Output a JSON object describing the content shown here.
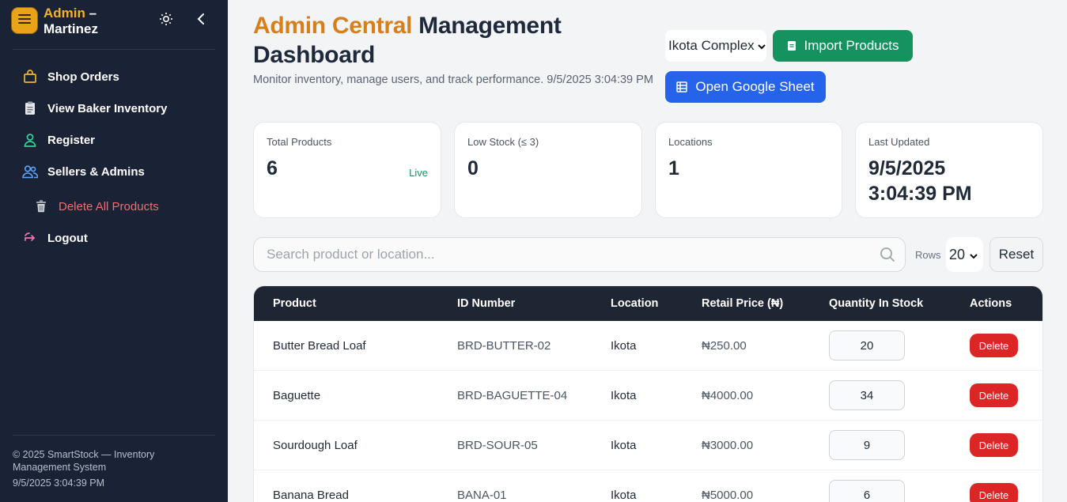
{
  "sidebar": {
    "brand_line1": "Admin",
    "brand_dash": " –",
    "brand_line2": "Martinez",
    "items": [
      {
        "label": "Shop Orders",
        "icon": "shopping-bag-icon"
      },
      {
        "label": "View Baker Inventory",
        "icon": "clipboard-icon"
      },
      {
        "label": "Register",
        "icon": "user-icon"
      },
      {
        "label": "Sellers & Admins",
        "icon": "users-icon"
      },
      {
        "label": "Delete All Products",
        "icon": "trash-icon"
      },
      {
        "label": "Logout",
        "icon": "logout-icon"
      }
    ],
    "footer_text": "© 2025 SmartStock — Inventory Management System",
    "footer_timestamp": "9/5/2025 3:04:39 PM"
  },
  "header": {
    "title_accent": "Admin Central",
    "title_rest": " Management Dashboard",
    "subtitle": "Monitor inventory, manage users, and track performance. 9/5/2025 3:04:39 PM",
    "location_selected": "Ikota Complex",
    "import_label": "Import Products",
    "sheet_label": "Open Google Sheet"
  },
  "stats": [
    {
      "label": "Total Products",
      "value": "6",
      "badge": "Live"
    },
    {
      "label": "Low Stock (≤ 3)",
      "value": "0"
    },
    {
      "label": "Locations",
      "value": "1"
    },
    {
      "label": "Last Updated",
      "value_line1": "9/5/2025",
      "value_line2": "3:04:39 PM"
    }
  ],
  "toolbar": {
    "search_placeholder": "Search product or location...",
    "rows_label": "Rows",
    "rows_value": "20",
    "reset_label": "Reset"
  },
  "table": {
    "headers": [
      "Product",
      "ID Number",
      "Location",
      "Retail Price (₦)",
      "Quantity In Stock",
      "Actions"
    ],
    "delete_label": "Delete",
    "rows": [
      {
        "product": "Butter Bread Loaf",
        "id": "BRD-BUTTER-02",
        "location": "Ikota",
        "price": "₦250.00",
        "qty": "20"
      },
      {
        "product": "Baguette",
        "id": "BRD-BAGUETTE-04",
        "location": "Ikota",
        "price": "₦4000.00",
        "qty": "34"
      },
      {
        "product": "Sourdough Loaf",
        "id": "BRD-SOUR-05",
        "location": "Ikota",
        "price": "₦3000.00",
        "qty": "9"
      },
      {
        "product": "Banana Bread",
        "id": "BANA-01",
        "location": "Ikota",
        "price": "₦5000.00",
        "qty": "6"
      }
    ]
  },
  "colors": {
    "sidebar_bg": "#1a2236",
    "accent_orange": "#d97f1a",
    "import_green": "#15935f",
    "sheet_blue": "#2563eb",
    "delete_red": "#dc2626",
    "table_head": "#1e2533"
  }
}
